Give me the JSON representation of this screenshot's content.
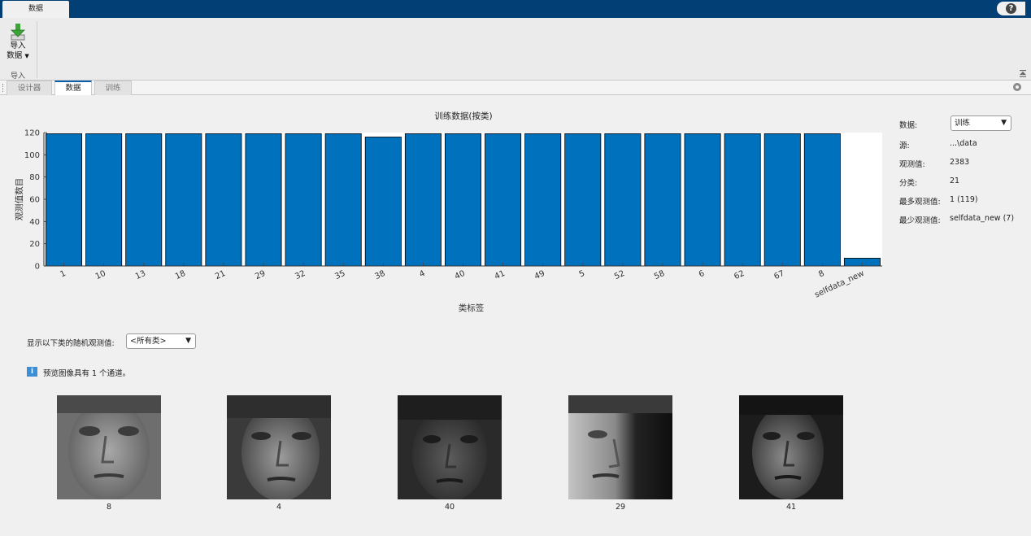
{
  "toolstrip": {
    "tab_label": "数据",
    "help_label": "?"
  },
  "ribbon": {
    "import_button_line1": "导入",
    "import_button_line2": "数据",
    "import_dropdown": "▼",
    "group_label": "导入"
  },
  "doc_tabs": [
    {
      "label": "设计器",
      "active": false
    },
    {
      "label": "数据",
      "active": true
    },
    {
      "label": "训练",
      "active": false
    }
  ],
  "panel": {
    "data_label": "数据:",
    "data_select_value": "训练",
    "source_label": "源:",
    "source_value": "...\\data",
    "observations_label": "观测值:",
    "observations_value": "2383",
    "classes_label": "分类:",
    "classes_value": "21",
    "most_label": "最多观测值:",
    "most_value": "1 (119)",
    "least_label": "最少观测值:",
    "least_value": "selfdata_new (7)"
  },
  "chart_data": {
    "type": "bar",
    "title": "训练数据(按类)",
    "xlabel": "类标签",
    "ylabel": "观测值数目",
    "categories": [
      "1",
      "10",
      "13",
      "18",
      "21",
      "29",
      "32",
      "35",
      "38",
      "4",
      "40",
      "41",
      "49",
      "5",
      "52",
      "58",
      "6",
      "62",
      "67",
      "8",
      "selfdata_new"
    ],
    "values": [
      119,
      119,
      119,
      119,
      119,
      119,
      119,
      119,
      116,
      119,
      119,
      119,
      119,
      119,
      119,
      119,
      119,
      119,
      119,
      119,
      7
    ],
    "ylim": [
      0,
      120
    ],
    "yticks": [
      0,
      20,
      40,
      60,
      80,
      100,
      120
    ],
    "bar_color": "#0072bd",
    "grid": false
  },
  "preview": {
    "random_label": "显示以下类的随机观测值:",
    "class_select_value": "<所有类>",
    "notice": "预览图像具有 1 个通道。",
    "images": [
      {
        "label": "8"
      },
      {
        "label": "4"
      },
      {
        "label": "40"
      },
      {
        "label": "29"
      },
      {
        "label": "41"
      }
    ]
  },
  "colors": {
    "title_bar": "#023f74",
    "accent": "#0b5fa8",
    "bar": "#0072bd"
  }
}
